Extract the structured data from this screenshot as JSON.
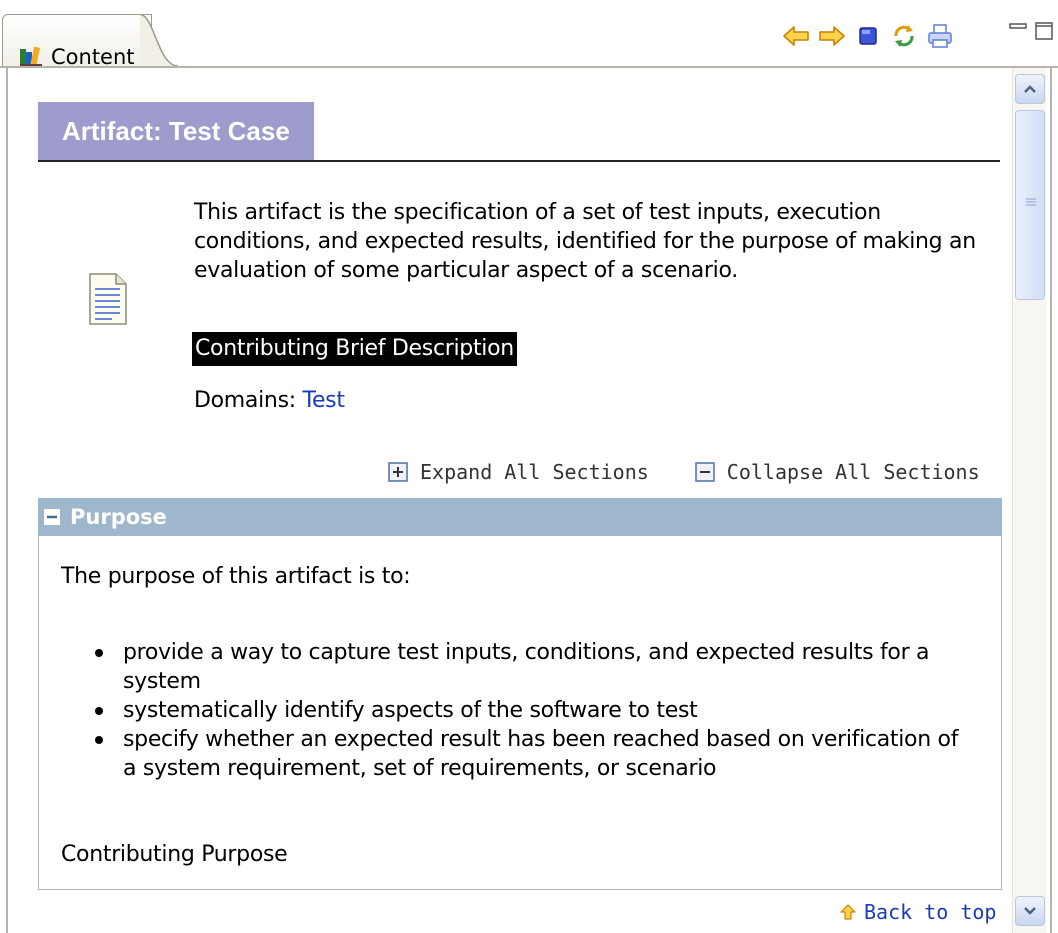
{
  "tab": {
    "label": "Content",
    "icon": "books-icon"
  },
  "toolbar": {
    "buttons": [
      "back-arrow-icon",
      "forward-arrow-icon",
      "stop-icon",
      "sync-icon",
      "print-icon"
    ],
    "window_buttons": [
      "minimize-icon",
      "maximize-icon"
    ]
  },
  "page": {
    "title": "Artifact: Test Case",
    "description": "This artifact is the specification of a set of test inputs, execution conditions, and expected results, identified for the purpose of making an evaluation of some particular aspect of a scenario.",
    "contributing_brief": "Contributing Brief Description",
    "domains_label": "Domains:",
    "domains_link": "Test",
    "expand_all": "Expand All Sections",
    "collapse_all": "Collapse All Sections",
    "back_to_top": "Back to top"
  },
  "purpose": {
    "heading": "Purpose",
    "intro": "The purpose of this artifact is to:",
    "bullets": [
      "provide a way to capture test inputs, conditions, and expected results for a system",
      "systematically identify aspects of the software to test",
      "specify whether an expected result has been reached based on verification of a system requirement, set of requirements, or scenario"
    ],
    "contributing": "Contributing Purpose"
  },
  "colors": {
    "title_bg": "#9d9ccc",
    "section_header_bg": "#9fb7cc",
    "link": "#1a3bb5",
    "toolbar_arrow": "#f0a800"
  }
}
